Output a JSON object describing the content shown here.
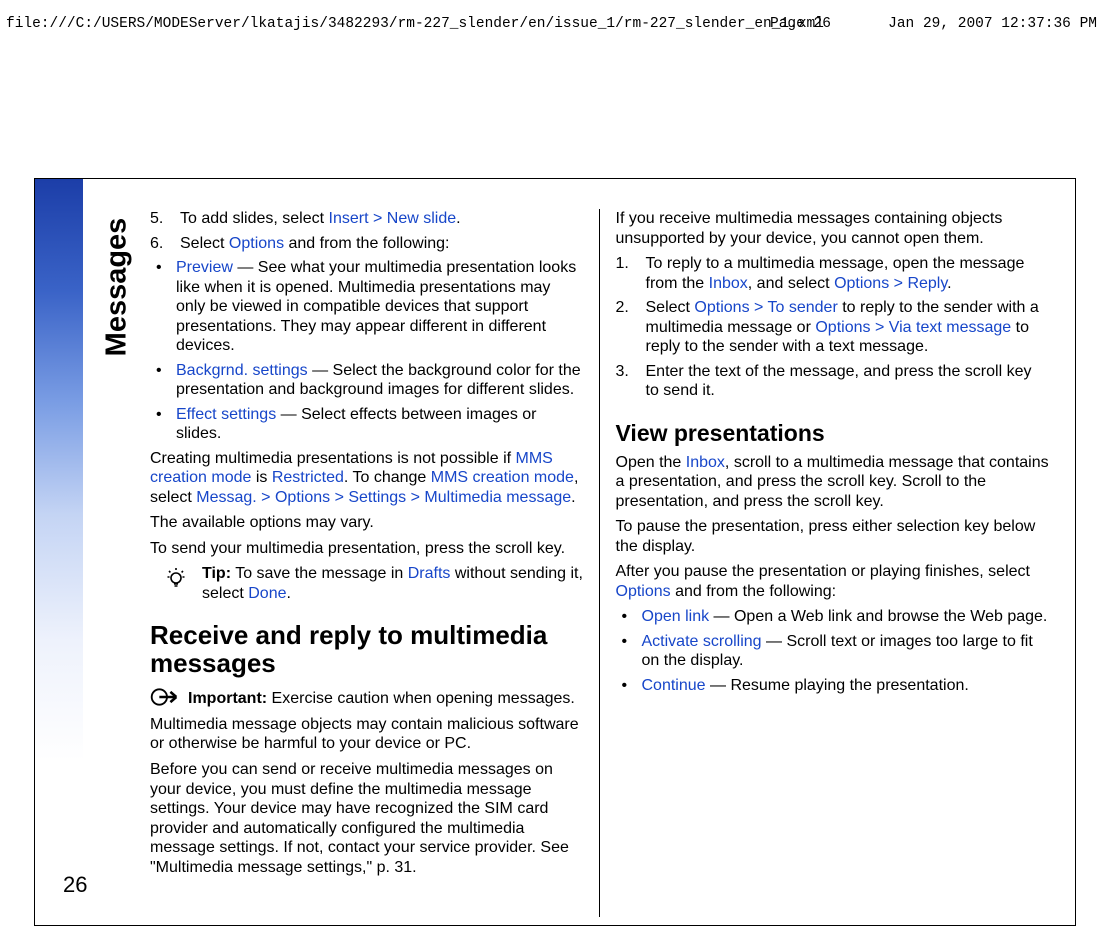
{
  "header": {
    "path": "file:///C:/USERS/MODEServer/lkatajis/3482293/rm-227_slender/en/issue_1/rm-227_slender_en_1.xml",
    "page": "Page 26",
    "datetime": "Jan 29, 2007 12:37:36 PM"
  },
  "side_tab": "Messages",
  "page_number": "26",
  "col1": {
    "step5_pre": "To add slides, select ",
    "step5_insert": "Insert",
    "step5_newslide": "New slide",
    "step5_post": ".",
    "step6_pre": "Select ",
    "step6_options": "Options",
    "step6_post": " and from the following:",
    "bullets": {
      "preview_term": "Preview",
      "preview_text": " — See what your multimedia presentation looks like when it is opened. Multimedia presentations may only be viewed in compatible devices that support presentations. They may appear different in different devices.",
      "bg_term": "Backgrnd. settings",
      "bg_text": " — Select the background color for the presentation and background images for different slides.",
      "fx_term": "Effect settings",
      "fx_text": " — Select effects between images or slides."
    },
    "para_cm_pre": "Creating multimedia presentations is not possible if ",
    "para_cm_mode1": "MMS creation mode",
    "para_cm_mid1": " is ",
    "para_cm_restricted": "Restricted",
    "para_cm_mid2": ". To change ",
    "para_cm_mode2": "MMS creation mode",
    "para_cm_mid3": ", select ",
    "para_cm_messag": "Messag.",
    "para_cm_options": "Options",
    "para_cm_settings": "Settings",
    "para_cm_mm": "Multimedia message",
    "para_cm_post": ".",
    "para_vary": "The available options may vary.",
    "para_send": "To send your multimedia presentation, press the scroll key.",
    "tip_label": "Tip:",
    "tip_pre": " To save the message in ",
    "tip_drafts": "Drafts",
    "tip_mid": " without sending it, select ",
    "tip_done": "Done",
    "tip_post": ".",
    "h2": "Receive and reply to multimedia messages",
    "imp_label": "Important: ",
    "imp_text": " Exercise caution when opening messages. Multimedia message objects may contain malicious software or otherwise be harmful to your device or PC."
  },
  "col2": {
    "para_settings": "Before you can send or receive multimedia messages on your device, you must define the multimedia message settings. Your device may have recognized the SIM card provider and automatically configured the multimedia message settings. If not, contact your service provider. See \"Multimedia message settings,\" p. 31.",
    "para_unsupported": "If you receive multimedia messages containing objects unsupported by your device, you cannot open them.",
    "ol": {
      "s1_pre": "To reply to a multimedia message, open the message from the ",
      "s1_inbox": "Inbox",
      "s1_mid": ", and select ",
      "s1_options": "Options",
      "s1_reply": "Reply",
      "s1_post": ".",
      "s2_pre": "Select ",
      "s2_options": "Options",
      "s2_tosender": "To sender",
      "s2_mid1": " to reply to the sender with a multimedia message or ",
      "s2_options2": "Options",
      "s2_viatext": "Via text message",
      "s2_post": " to reply to the sender with a text message.",
      "s3": "Enter the text of the message, and press the scroll key to send it."
    },
    "h3": "View presentations",
    "vp_p1_pre": "Open the ",
    "vp_p1_inbox": "Inbox",
    "vp_p1_post": ", scroll to a multimedia message that contains a presentation, and press the scroll key. Scroll to the presentation, and press the scroll key.",
    "vp_p2": "To pause the presentation, press either selection key below the display.",
    "vp_p3_pre": "After you pause the presentation or playing finishes, select ",
    "vp_p3_options": "Options",
    "vp_p3_post": " and from the following:",
    "bullets": {
      "ol_term": "Open link",
      "ol_text": " — Open a Web link and browse the Web page.",
      "as_term": "Activate scrolling",
      "as_text": " — Scroll text or images too large to fit on the display.",
      "co_term": "Continue",
      "co_text": " — Resume playing the presentation."
    }
  }
}
